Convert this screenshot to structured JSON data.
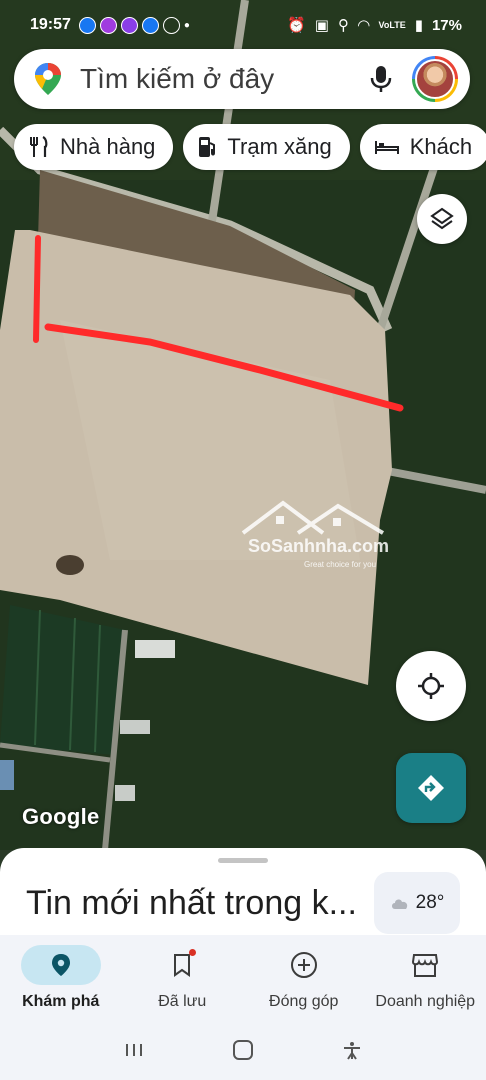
{
  "status_bar": {
    "time": "19:57",
    "battery": "17%",
    "network": "VoLTE"
  },
  "search": {
    "placeholder": "Tìm kiếm ở đây"
  },
  "chips": [
    {
      "label": "Nhà hàng",
      "icon": "restaurant-icon"
    },
    {
      "label": "Trạm xăng",
      "icon": "gas-station-icon"
    },
    {
      "label": "Khách",
      "icon": "hotel-icon"
    }
  ],
  "map": {
    "attribution": "Google",
    "watermark": {
      "brand": "SoSanhnha.com",
      "tagline": "Great choice for you"
    }
  },
  "sheet": {
    "title": "Tin mới nhất trong k...",
    "weather": "28°"
  },
  "bottom_nav": [
    {
      "label": "Khám phá",
      "icon": "explore-pin-icon",
      "active": true
    },
    {
      "label": "Đã lưu",
      "icon": "bookmark-icon",
      "active": false,
      "badge": true
    },
    {
      "label": "Đóng góp",
      "icon": "add-circle-icon",
      "active": false
    },
    {
      "label": "Doanh nghiệp",
      "icon": "storefront-icon",
      "active": false
    }
  ],
  "colors": {
    "accent": "#1a7f86",
    "active_nav_bg": "#c7e6f2",
    "marker_line": "#ff2a2a"
  }
}
